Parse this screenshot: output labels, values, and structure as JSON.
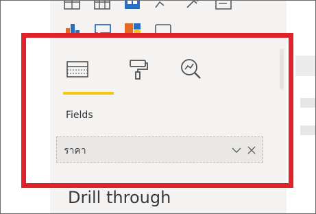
{
  "fields_tab": {
    "label": "Fields",
    "active": true,
    "accent_color": "#f2c811"
  },
  "field_well": {
    "value": "ราคา"
  },
  "drill_through": {
    "title": "Drill through"
  },
  "annotation": {
    "highlight_color": "#e0232a"
  },
  "icons": {
    "visualizations": [
      "table-icon",
      "matrix-icon",
      "map-icon",
      "chart-icon",
      "custom-visual-icon",
      "card-icon",
      "bar-chart-icon",
      "comment-icon",
      "treemap-icon",
      "more-visuals-icon"
    ],
    "tabs": [
      "fields-icon",
      "format-icon",
      "analytics-icon"
    ]
  }
}
